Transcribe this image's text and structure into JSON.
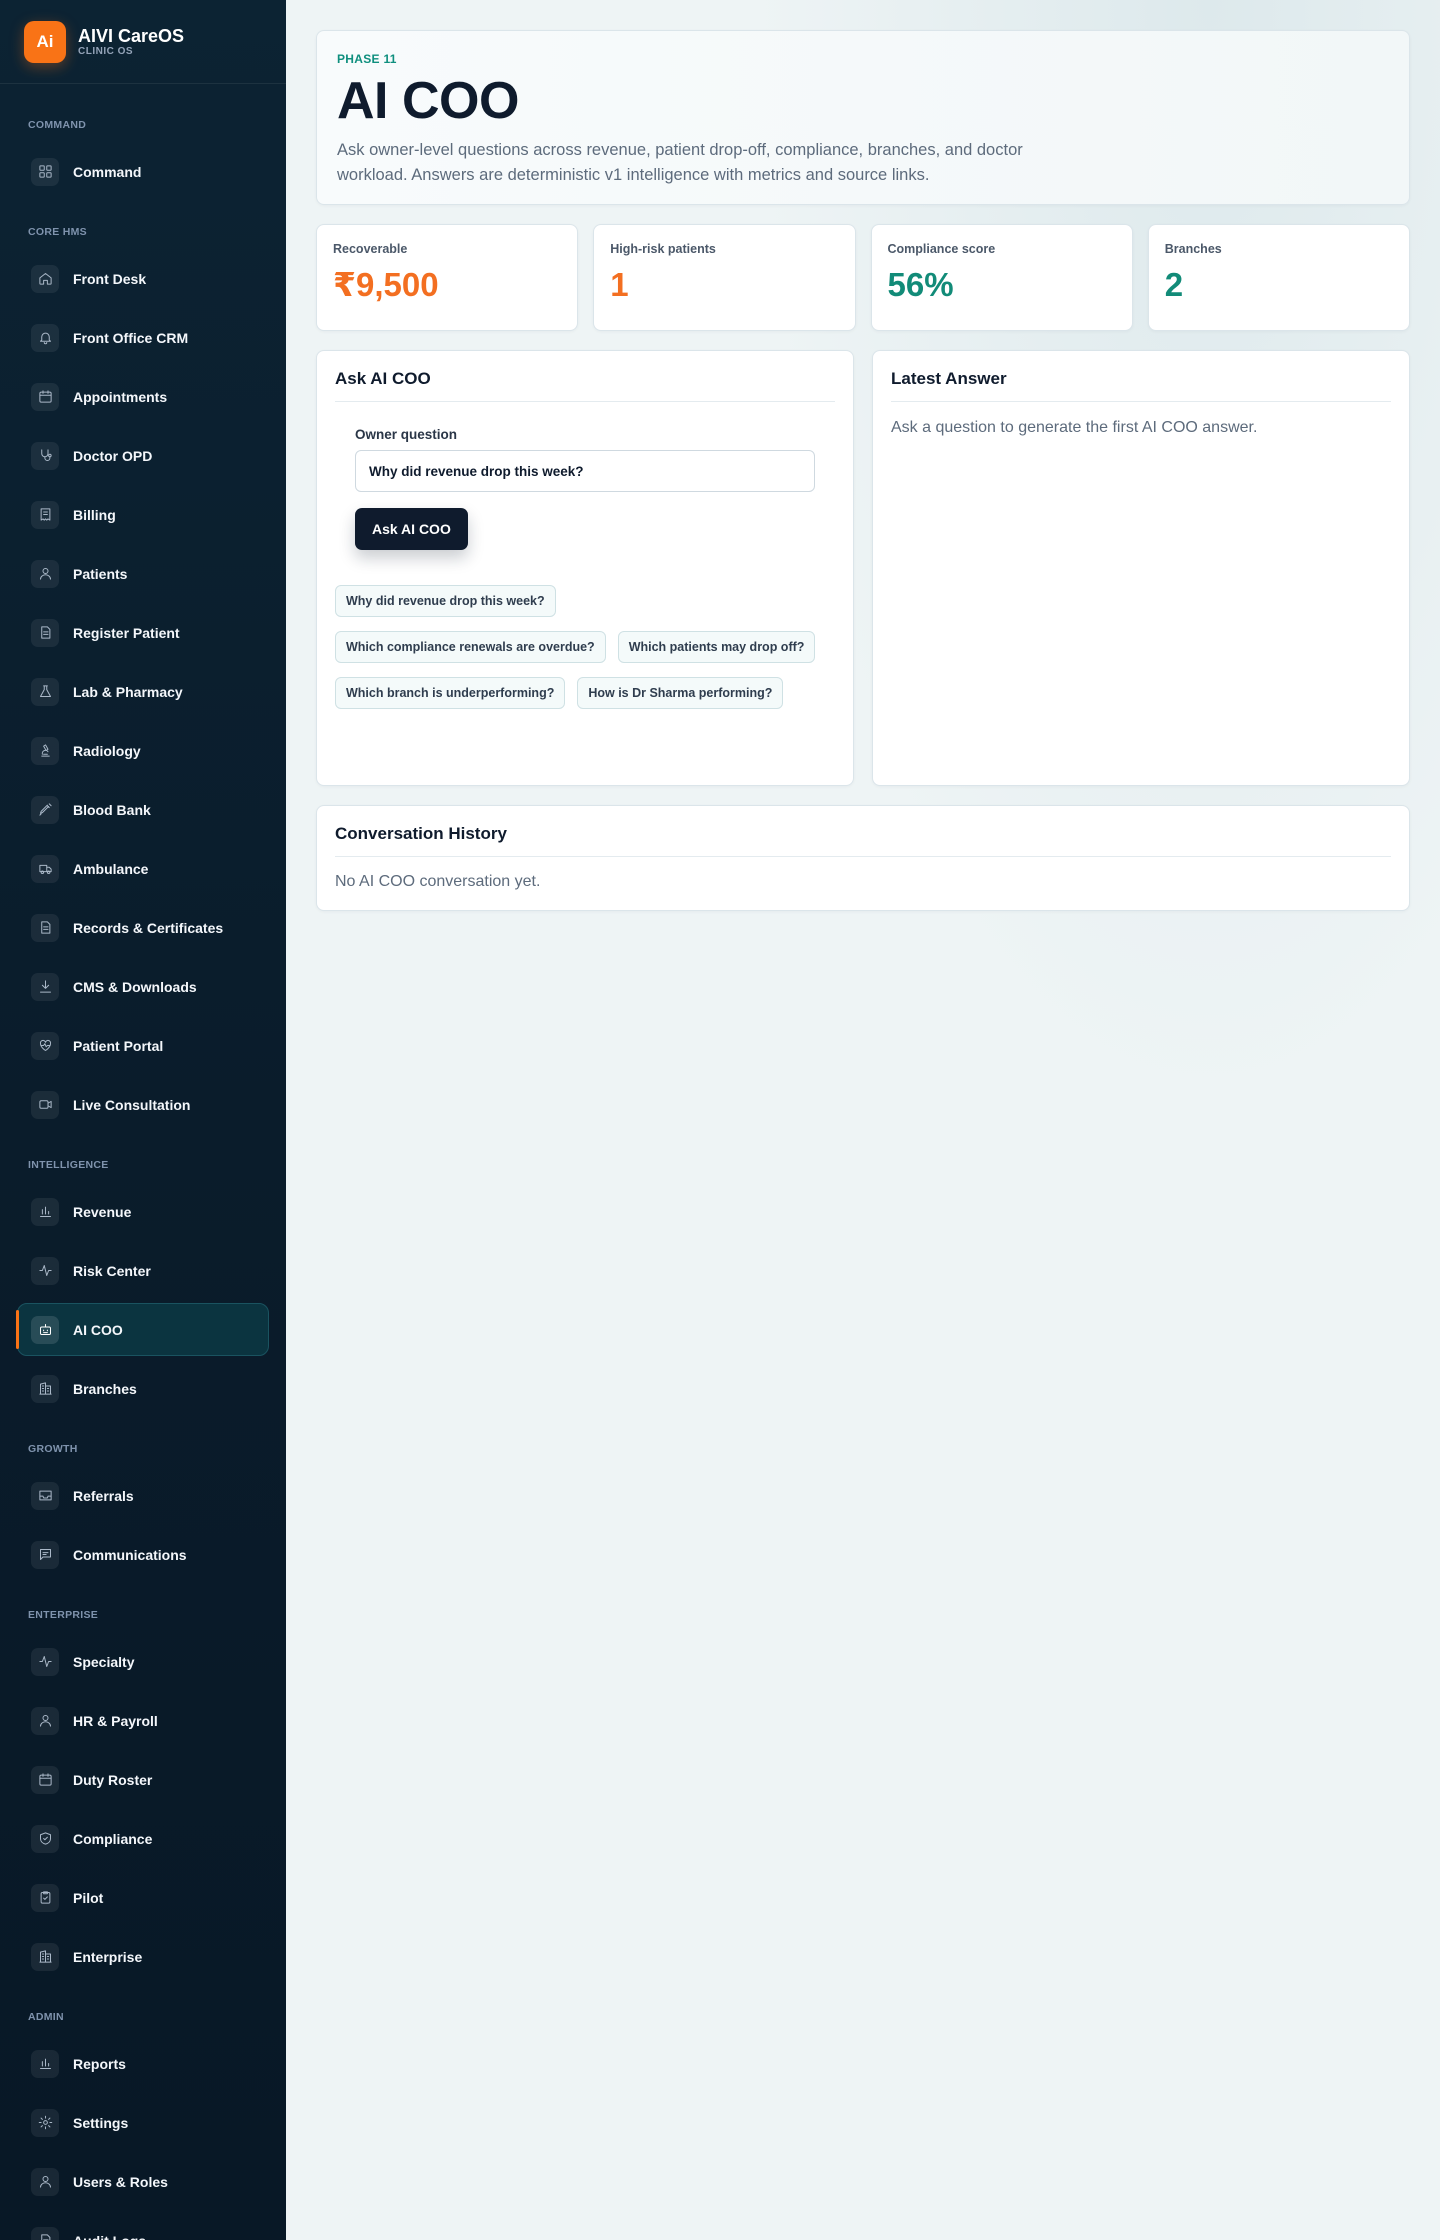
{
  "brand": {
    "logo": "Ai",
    "name": "AIVI CareOS",
    "subtitle": "CLINIC OS"
  },
  "nav": [
    {
      "group": "COMMAND",
      "items": [
        {
          "label": "Command",
          "icon": "grid-icon"
        }
      ]
    },
    {
      "group": "CORE HMS",
      "items": [
        {
          "label": "Front Desk",
          "icon": "home-icon"
        },
        {
          "label": "Front Office CRM",
          "icon": "bell-icon"
        },
        {
          "label": "Appointments",
          "icon": "calendar-icon"
        },
        {
          "label": "Doctor OPD",
          "icon": "stethoscope-icon"
        },
        {
          "label": "Billing",
          "icon": "receipt-icon"
        },
        {
          "label": "Patients",
          "icon": "user-icon"
        },
        {
          "label": "Register Patient",
          "icon": "document-icon"
        },
        {
          "label": "Lab & Pharmacy",
          "icon": "flask-icon"
        },
        {
          "label": "Radiology",
          "icon": "microscope-icon"
        },
        {
          "label": "Blood Bank",
          "icon": "syringe-icon"
        },
        {
          "label": "Ambulance",
          "icon": "ambulance-icon"
        },
        {
          "label": "Records & Certificates",
          "icon": "document-icon"
        },
        {
          "label": "CMS & Downloads",
          "icon": "download-icon"
        },
        {
          "label": "Patient Portal",
          "icon": "heart-pulse-icon"
        },
        {
          "label": "Live Consultation",
          "icon": "video-icon"
        }
      ]
    },
    {
      "group": "INTELLIGENCE",
      "items": [
        {
          "label": "Revenue",
          "icon": "bar-chart-icon"
        },
        {
          "label": "Risk Center",
          "icon": "activity-icon"
        },
        {
          "label": "AI COO",
          "icon": "robot-icon",
          "active": true
        },
        {
          "label": "Branches",
          "icon": "building-icon"
        }
      ]
    },
    {
      "group": "GROWTH",
      "items": [
        {
          "label": "Referrals",
          "icon": "inbox-icon"
        },
        {
          "label": "Communications",
          "icon": "message-icon"
        }
      ]
    },
    {
      "group": "ENTERPRISE",
      "items": [
        {
          "label": "Specialty",
          "icon": "activity-icon"
        },
        {
          "label": "HR & Payroll",
          "icon": "user-icon"
        },
        {
          "label": "Duty Roster",
          "icon": "calendar-icon"
        },
        {
          "label": "Compliance",
          "icon": "shield-icon"
        },
        {
          "label": "Pilot",
          "icon": "clipboard-icon"
        },
        {
          "label": "Enterprise",
          "icon": "building-icon"
        }
      ]
    },
    {
      "group": "ADMIN",
      "items": [
        {
          "label": "Reports",
          "icon": "bar-chart-icon"
        },
        {
          "label": "Settings",
          "icon": "gear-icon"
        },
        {
          "label": "Users & Roles",
          "icon": "user-icon"
        },
        {
          "label": "Audit Logs",
          "icon": "document-icon"
        }
      ]
    }
  ],
  "hero": {
    "phase": "PHASE 11",
    "title": "AI COO",
    "description": "Ask owner-level questions across revenue, patient drop-off, compliance, branches, and doctor workload. Answers are deterministic v1 intelligence with metrics and source links."
  },
  "kpis": [
    {
      "label": "Recoverable",
      "value": "₹9,500",
      "color": "#f36f21"
    },
    {
      "label": "High-risk patients",
      "value": "1",
      "color": "#f36f21"
    },
    {
      "label": "Compliance score",
      "value": "56%",
      "color": "#128b78"
    },
    {
      "label": "Branches",
      "value": "2",
      "color": "#128b78"
    }
  ],
  "ask": {
    "title": "Ask AI COO",
    "field_label": "Owner question",
    "input_value": "Why did revenue drop this week?",
    "button_label": "Ask AI COO",
    "suggestions": [
      "Why did revenue drop this week?",
      "Which compliance renewals are overdue?",
      "Which patients may drop off?",
      "Which branch is underperforming?",
      "How is Dr Sharma performing?"
    ]
  },
  "answer": {
    "title": "Latest Answer",
    "empty": "Ask a question to generate the first AI COO answer."
  },
  "history": {
    "title": "Conversation History",
    "empty": "No AI COO conversation yet."
  },
  "colors": {
    "accent": "#f97316",
    "sidebar": "#0a1c2b",
    "teal": "#128b78",
    "dark": "#0f1b2d"
  }
}
